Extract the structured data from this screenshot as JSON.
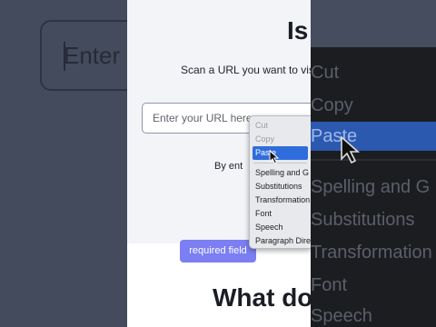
{
  "left_zoom": {
    "input_placeholder": "Enter"
  },
  "page": {
    "title": "Is",
    "subtitle": "Scan a URL you want to vis",
    "url_input": {
      "placeholder": "Enter your URL here",
      "value": ""
    },
    "by_text": "By ent",
    "section_heading": "What do",
    "tooltip": "required field"
  },
  "context_menu": {
    "items": [
      {
        "label": "Cut",
        "state": "disabled"
      },
      {
        "label": "Copy",
        "state": "disabled"
      },
      {
        "label": "Paste",
        "state": "selected"
      },
      {
        "label": "Spelling and G",
        "state": "normal"
      },
      {
        "label": "Substitutions",
        "state": "normal"
      },
      {
        "label": "Transformation",
        "state": "normal"
      },
      {
        "label": "Font",
        "state": "normal"
      },
      {
        "label": "Speech",
        "state": "normal"
      },
      {
        "label": "Paragraph Dire",
        "state": "normal"
      }
    ]
  },
  "zoomed_menu": {
    "items": [
      {
        "label": "Cut",
        "state": "disabled"
      },
      {
        "label": "Copy",
        "state": "disabled"
      },
      {
        "label": "Paste",
        "state": "selected"
      },
      {
        "label": "Spelling and G",
        "state": "disabled"
      },
      {
        "label": "Substitutions",
        "state": "disabled"
      },
      {
        "label": "Transformation",
        "state": "disabled"
      },
      {
        "label": "Font",
        "state": "disabled"
      },
      {
        "label": "Speech",
        "state": "disabled"
      }
    ]
  },
  "colors": {
    "accent_selected": "#2f6ddd",
    "tooltip_bg": "#7b7ff2",
    "backdrop": "#454d5e"
  },
  "icons": [
    "arrow-cursor-icon",
    "text-caret-icon"
  ]
}
